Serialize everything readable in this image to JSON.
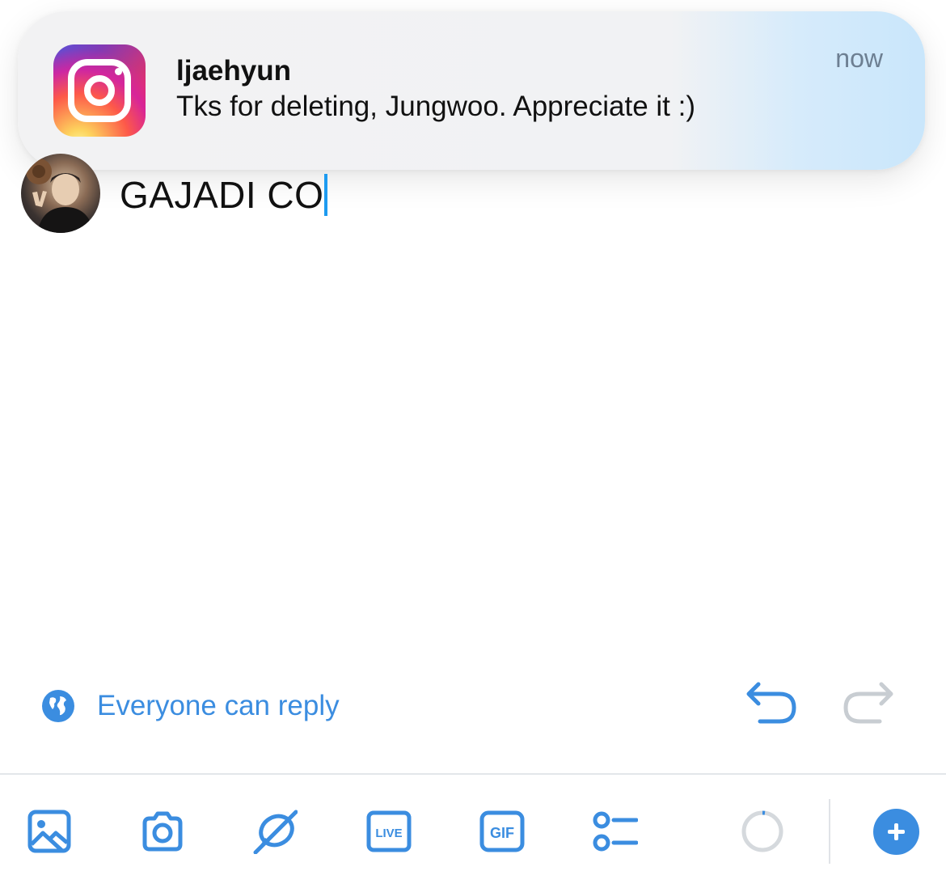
{
  "notification": {
    "app_icon": "instagram-icon",
    "sender": "ljaehyun",
    "message": "Tks for deleting, Jungwoo. Appreciate it :)",
    "time": "now"
  },
  "composer": {
    "text": "GAJADI CO",
    "avatar": "user-avatar"
  },
  "reply_settings": {
    "icon": "globe-icon",
    "label": "Everyone can reply"
  },
  "toolbar": {
    "items": [
      "image-icon",
      "camera-icon",
      "location-icon",
      "live-icon",
      "gif-icon",
      "poll-icon",
      "character-count-ring",
      "add-thread-icon"
    ],
    "live_label": "LIVE",
    "gif_label": "GIF"
  },
  "colors": {
    "accent": "#3b8de0",
    "text": "#111111",
    "muted": "#6d7f92",
    "disabled": "#c8cdd2"
  }
}
